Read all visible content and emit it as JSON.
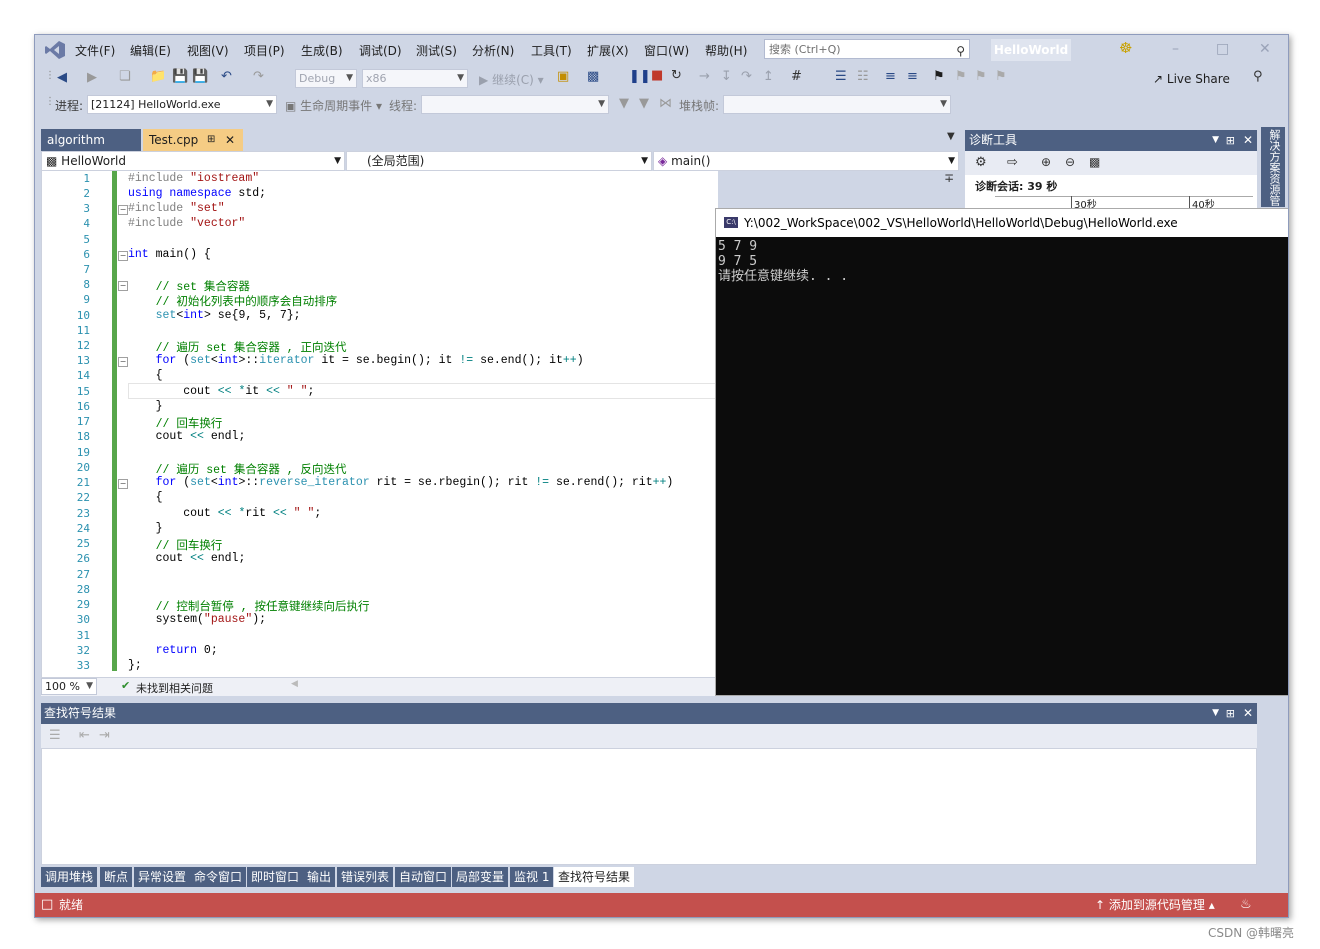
{
  "menu": {
    "items": [
      "文件(F)",
      "编辑(E)",
      "视图(V)",
      "项目(P)",
      "生成(B)",
      "调试(D)",
      "测试(S)",
      "分析(N)",
      "工具(T)",
      "扩展(X)",
      "窗口(W)",
      "帮助(H)"
    ],
    "search_placeholder": "搜索 (Ctrl+Q)",
    "solution_name": "HelloWorld"
  },
  "toolbar": {
    "config": "Debug",
    "platform": "x86",
    "continue_label": "继续(C)",
    "live_share": "Live Share",
    "process_label": "进程:",
    "process_value": "[21124] HelloWorld.exe",
    "lifecycle_label": "生命周期事件",
    "thread_label": "线程:",
    "stackframe_label": "堆栈帧:"
  },
  "editor": {
    "tabs": [
      {
        "label": "algorithm",
        "active": false
      },
      {
        "label": "Test.cpp",
        "active": true
      }
    ],
    "nav_project": "HelloWorld",
    "nav_scope": "(全局范围)",
    "nav_member": "main()",
    "line_numbers": [
      "1",
      "2",
      "3",
      "4",
      "5",
      "6",
      "7",
      "8",
      "9",
      "10",
      "11",
      "12",
      "13",
      "14",
      "15",
      "16",
      "17",
      "18",
      "19",
      "20",
      "21",
      "22",
      "23",
      "24",
      "25",
      "26",
      "27",
      "28",
      "29",
      "30",
      "31",
      "32",
      "33"
    ],
    "zoom": "100 %",
    "issues": "未找到相关问题"
  },
  "console": {
    "title": "Y:\\002_WorkSpace\\002_VS\\HelloWorld\\HelloWorld\\Debug\\HelloWorld.exe",
    "output": "5 7 9\n9 7 5\n请按任意键继续. . ."
  },
  "diagnostics": {
    "title": "诊断工具",
    "session": "诊断会话: 39 秒",
    "tick_30": "30秒",
    "tick_40": "40秒",
    "side_tab": "解决方案资源管"
  },
  "find_panel": {
    "title": "查找符号结果"
  },
  "bottom_tabs": [
    "调用堆栈",
    "断点",
    "异常设置",
    "命令窗口",
    "即时窗口",
    "输出",
    "错误列表",
    "自动窗口",
    "局部变量",
    "监视 1",
    "查找符号结果"
  ],
  "status": {
    "ready": "就绪",
    "source_control": "添加到源代码管理"
  },
  "watermark": "CSDN @韩曙亮",
  "colors": {
    "chrome": "#cfd6e5",
    "panel_header": "#4d6082",
    "active_tab": "#f5cc84",
    "status_debug": "#c4504d",
    "change_bar": "#57a64a"
  }
}
